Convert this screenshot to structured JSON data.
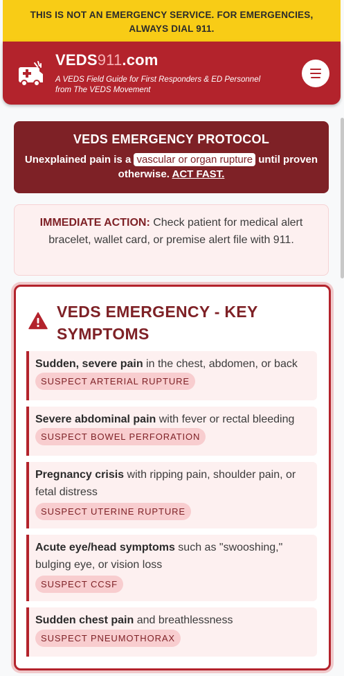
{
  "banner": {
    "line1": "THIS IS NOT AN EMERGENCY SERVICE. FOR EMERGENCIES,",
    "line2": "ALWAYS DIAL 911."
  },
  "header": {
    "brand_prefix": "VEDS",
    "brand_number": "911",
    "brand_suffix": ".com",
    "tagline_line1": "A VEDS Field Guide for First Responders & ED Personnel",
    "tagline_line2": "from The VEDS Movement",
    "logo_icon": "ambulance-icon",
    "menu_icon": "hamburger-menu-icon"
  },
  "protocol": {
    "title": "VEDS EMERGENCY PROTOCOL",
    "text_before": "Unexplained pain is a",
    "highlight": "vascular or organ rupture",
    "text_after": "until proven otherwise.",
    "act_fast": "ACT FAST."
  },
  "immediate": {
    "label": "IMMEDIATE ACTION:",
    "text": "Check patient for medical alert bracelet, wallet card, or premise alert file with 911."
  },
  "symptoms": {
    "title_line1": "VEDS EMERGENCY - KEY",
    "title_line2": "SYMPTOMS",
    "icon": "warning-triangle-icon",
    "items": [
      {
        "bold": "Sudden, severe pain",
        "text": " in the chest, abdomen, or back ",
        "tag": "SUSPECT ARTERIAL RUPTURE"
      },
      {
        "bold": "Severe abdominal pain",
        "text": " with fever or rectal bleeding ",
        "tag": "SUSPECT BOWEL PERFORATION"
      },
      {
        "bold": "Pregnancy crisis",
        "text": " with ripping pain, shoulder pain, or fetal distress",
        "tag": "SUSPECT UTERINE RUPTURE"
      },
      {
        "bold": "Acute eye/head symptoms",
        "text": " such as \"swooshing,\" bulging eye, or vision loss",
        "tag": "SUSPECT CCSF"
      },
      {
        "bold": "Sudden chest pain",
        "text": " and breathlessness",
        "tag": "SUSPECT PNEUMOTHORAX"
      }
    ]
  },
  "colors": {
    "banner": "#f8cc16",
    "brand_red": "#b3232c",
    "dark_red": "#7e2126",
    "tag_bg": "#f8cdcf",
    "item_bg": "#fdf0f0"
  }
}
